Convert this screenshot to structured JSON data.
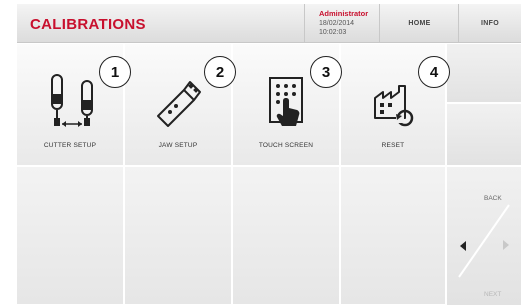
{
  "header": {
    "title": "CALIBRATIONS",
    "user": {
      "name": "Administrator",
      "date": "18/02/2014",
      "time": "10:02:03"
    },
    "home_label": "HOME",
    "info_label": "INFO"
  },
  "menu": [
    {
      "label": "CUTTER SETUP",
      "badge": "1",
      "icon": "cutter-setup-icon"
    },
    {
      "label": "JAW SETUP",
      "badge": "2",
      "icon": "jaw-setup-icon"
    },
    {
      "label": "TOUCH SCREEN",
      "badge": "3",
      "icon": "touch-screen-icon"
    },
    {
      "label": "RESET",
      "badge": "4",
      "icon": "reset-icon"
    }
  ],
  "nav": {
    "back_label": "BACK",
    "next_label": "NEXT",
    "prev_icon": "arrow-left-icon",
    "next_icon": "arrow-right-icon"
  },
  "colors": {
    "title": "#c8102e",
    "user": "#c8102e",
    "next_disabled": "#b8b8b8"
  }
}
